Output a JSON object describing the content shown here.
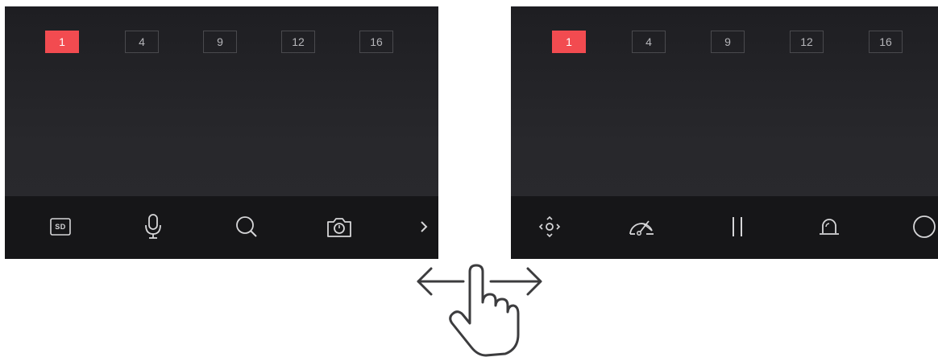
{
  "left_screen": {
    "window_tabs": [
      {
        "label": "1",
        "active": true
      },
      {
        "label": "4",
        "active": false
      },
      {
        "label": "9",
        "active": false
      },
      {
        "label": "12",
        "active": false
      },
      {
        "label": "16",
        "active": false
      }
    ],
    "toolbar": [
      {
        "icon": "sd-card-icon",
        "text": "SD"
      },
      {
        "icon": "microphone-icon"
      },
      {
        "icon": "search-icon"
      },
      {
        "icon": "camera-icon"
      },
      {
        "icon": "chevron-right-icon"
      }
    ]
  },
  "right_screen": {
    "window_tabs": [
      {
        "label": "1",
        "active": true
      },
      {
        "label": "4",
        "active": false
      },
      {
        "label": "9",
        "active": false
      },
      {
        "label": "12",
        "active": false
      },
      {
        "label": "16",
        "active": false
      }
    ],
    "toolbar": [
      {
        "icon": "ptz-direction-icon"
      },
      {
        "icon": "speed-gauge-icon"
      },
      {
        "icon": "pause-icon"
      },
      {
        "icon": "alarm-light-icon"
      },
      {
        "icon": "circle-icon"
      }
    ]
  },
  "gesture": {
    "icon": "swipe-hand-icon",
    "direction": "left-right"
  },
  "colors": {
    "active_tab": "#f24b50",
    "screen_bg": "#232327",
    "toolbar_bg": "#161618",
    "gesture_stroke": "#3c3c3e"
  }
}
